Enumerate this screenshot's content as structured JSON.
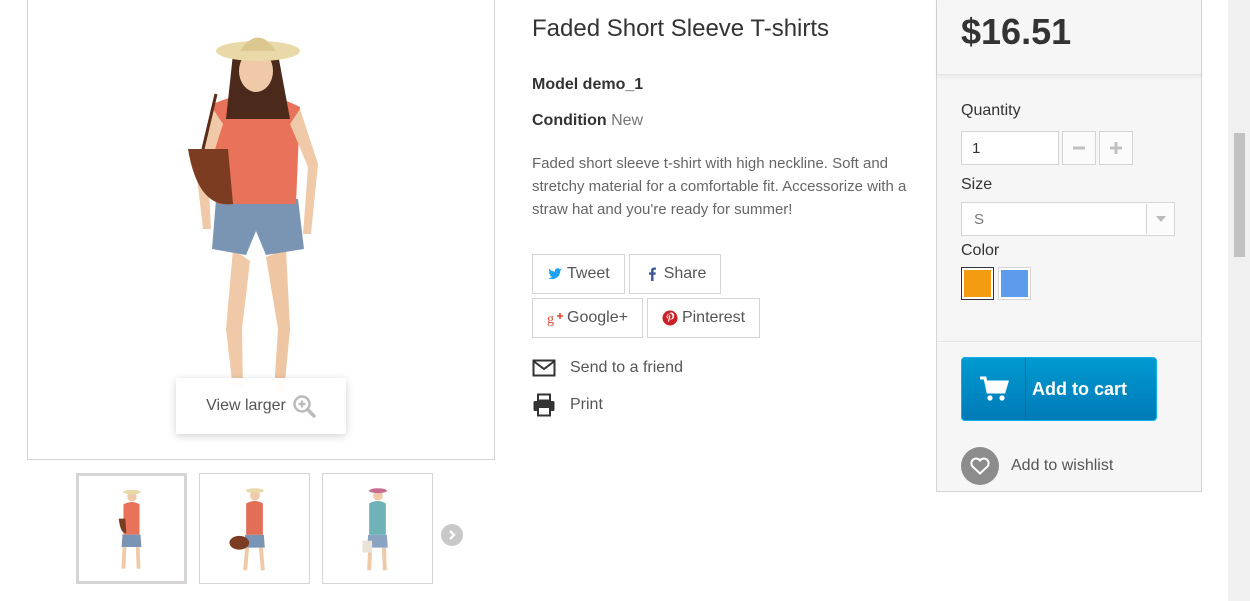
{
  "product": {
    "title": "Faded Short Sleeve T-shirts",
    "model_label": "Model",
    "model_value": "demo_1",
    "condition_label": "Condition",
    "condition_value": "New",
    "description": "Faded short sleeve t-shirt with high neckline. Soft and stretchy material for a comfortable fit. Accessorize with a straw hat and you're ready for summer!"
  },
  "image": {
    "view_larger_label": "View larger"
  },
  "social": {
    "tweet": "Tweet",
    "share": "Share",
    "google": "Google+",
    "pinterest": "Pinterest"
  },
  "actions": {
    "send_to_friend": "Send to a friend",
    "print": "Print"
  },
  "buybox": {
    "price": "$16.51",
    "quantity_label": "Quantity",
    "quantity_value": "1",
    "size_label": "Size",
    "size_value": "S",
    "color_label": "Color",
    "colors": [
      "#f39c11",
      "#5d9cec"
    ],
    "add_to_cart": "Add to cart",
    "add_to_wishlist": "Add to wishlist"
  },
  "icons": {
    "zoom": "zoom-in-icon",
    "twitter": "twitter-icon",
    "facebook": "facebook-icon",
    "google": "google-plus-icon",
    "pinterest": "pinterest-icon",
    "mail": "envelope-icon",
    "print": "printer-icon",
    "cart": "cart-icon",
    "heart": "heart-icon",
    "next": "chevron-right-icon"
  }
}
